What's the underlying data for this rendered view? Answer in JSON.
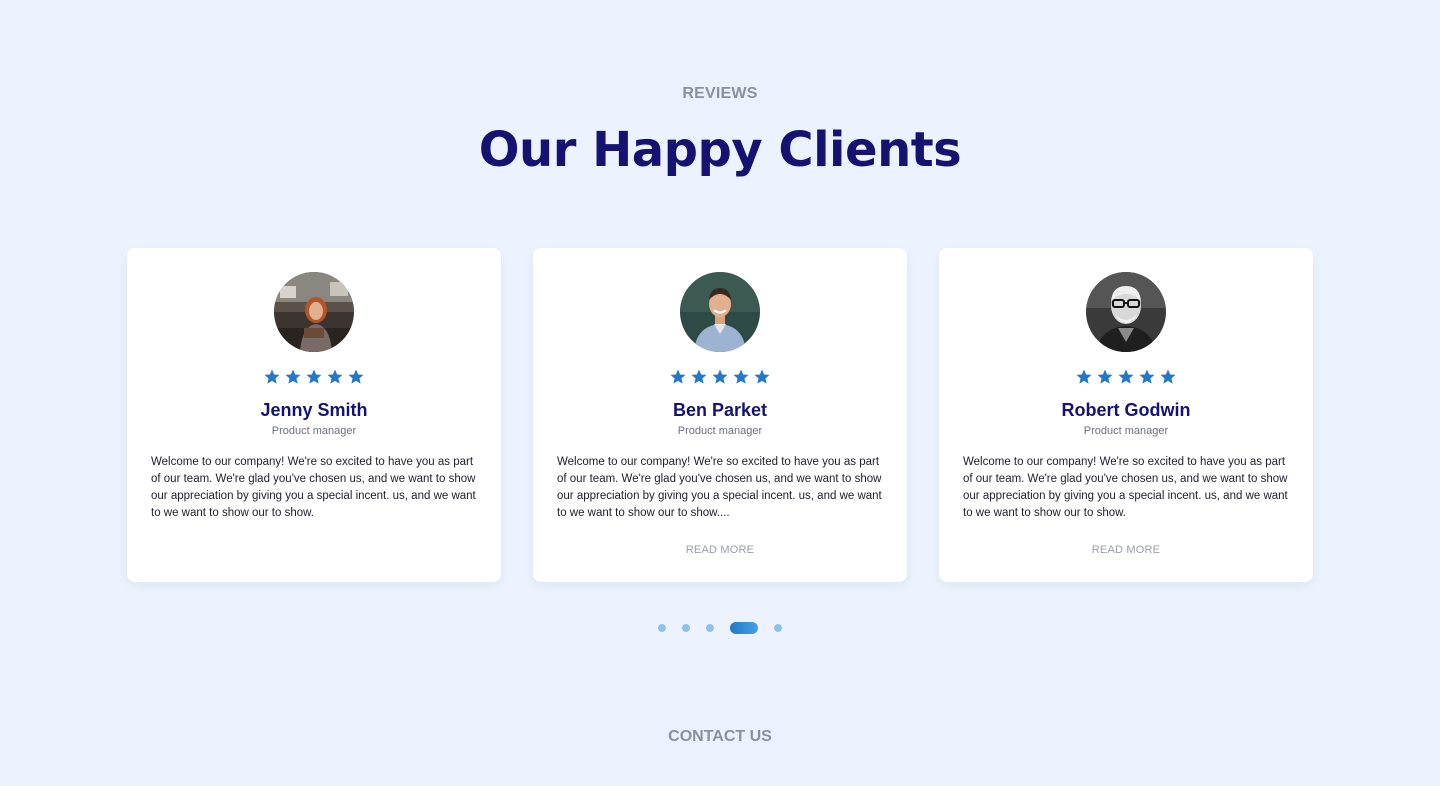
{
  "section": {
    "eyebrow": "REVIEWS",
    "title": "Our Happy Clients"
  },
  "colors": {
    "accent": "#2478c8",
    "title": "#161272",
    "background": "#edf3fe"
  },
  "reviews": [
    {
      "name": "Jenny Smith",
      "role": "Product manager",
      "rating": 5,
      "text": "Welcome to our company! We're so excited to have you as part of our team. We're glad you've chosen us, and we want to show our appreciation by giving you a special incent. us, and we want to we want to show our to show.",
      "read_more": ""
    },
    {
      "name": "Ben Parket",
      "role": "Product manager",
      "rating": 5,
      "text": "Welcome to our company! We're so excited to have you as part of our team. We're glad you've chosen us, and we want to show our appreciation by giving you a special incent. us, and we want to we want to show our to show....",
      "read_more": "READ MORE"
    },
    {
      "name": "Robert Godwin",
      "role": "Product manager",
      "rating": 5,
      "text": "Welcome to our company! We're so excited to have you as part of our team. We're glad you've chosen us, and we want to show our appreciation by giving you a special incent. us, and we want to we want to show our to show.",
      "read_more": "READ MORE"
    }
  ],
  "pagination": {
    "count": 5,
    "active_index": 3
  },
  "next_section": {
    "eyebrow": "CONTACT US"
  }
}
